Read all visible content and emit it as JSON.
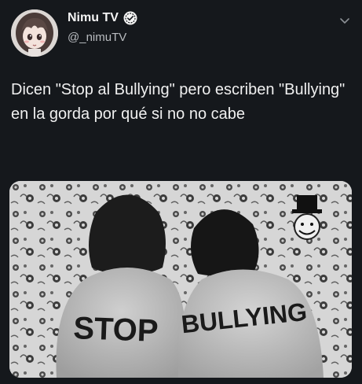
{
  "tweet": {
    "display_name": "Nimu TV",
    "handle": "@_nimuTV",
    "text": "Dicen \"Stop al Bullying\" pero escriben \"Bullying\" en la gorda por qué si no no cabe",
    "image": {
      "word_left": "STOP",
      "word_right": "BULLYING"
    }
  },
  "icons": {
    "verified": "verified-badge-icon",
    "more": "chevron-down-icon"
  },
  "colors": {
    "background": "#15181c",
    "text": "#e7e9ea",
    "handle": "#b9bcc0"
  }
}
